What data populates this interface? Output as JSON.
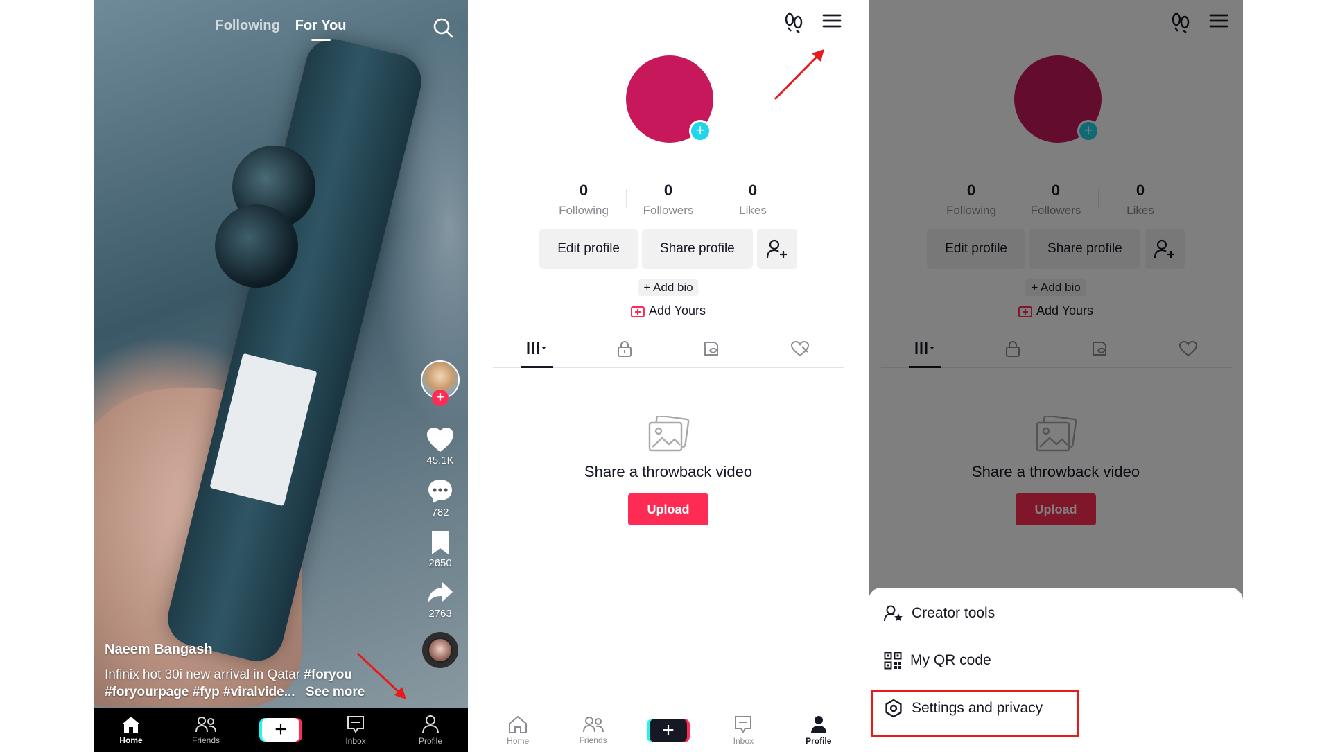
{
  "feed": {
    "tabs": [
      "Following",
      "For You"
    ],
    "active_tab": "For You",
    "creator": "Naeem Bangash",
    "caption_text": "Infinix hot 30i new arrival in Qatar",
    "caption_tags_line1": "#foryou",
    "caption_tags_line2": "#foryourpage #fyp #viralvide...",
    "see_more": "See more",
    "likes": "45.1K",
    "comments": "782",
    "saves": "2650",
    "shares": "2763"
  },
  "nav": {
    "home": "Home",
    "friends": "Friends",
    "inbox": "Inbox",
    "profile": "Profile",
    "create_symbol": "+"
  },
  "profile": {
    "following_count": "0",
    "following_label": "Following",
    "followers_count": "0",
    "followers_label": "Followers",
    "likes_count": "0",
    "likes_label": "Likes",
    "edit_profile": "Edit profile",
    "share_profile": "Share profile",
    "add_bio": "+ Add bio",
    "add_yours": "Add Yours",
    "empty_title": "Share a throwback video",
    "upload": "Upload",
    "avatar_color": "#c8185c",
    "accent": "#fe2c55"
  },
  "menu": {
    "creator_tools": "Creator tools",
    "qr_code": "My QR code",
    "settings": "Settings and privacy"
  },
  "icons": [
    "search-icon",
    "heart-icon",
    "comment-icon",
    "bookmark-icon",
    "share-icon",
    "home-icon",
    "friends-icon",
    "inbox-icon",
    "profile-icon",
    "footprints-icon",
    "menu-icon",
    "add-friend-icon",
    "grid-icon",
    "lock-icon",
    "repost-icon",
    "liked-icon",
    "photo-icon",
    "creator-tools-icon",
    "qr-code-icon",
    "gear-icon"
  ]
}
